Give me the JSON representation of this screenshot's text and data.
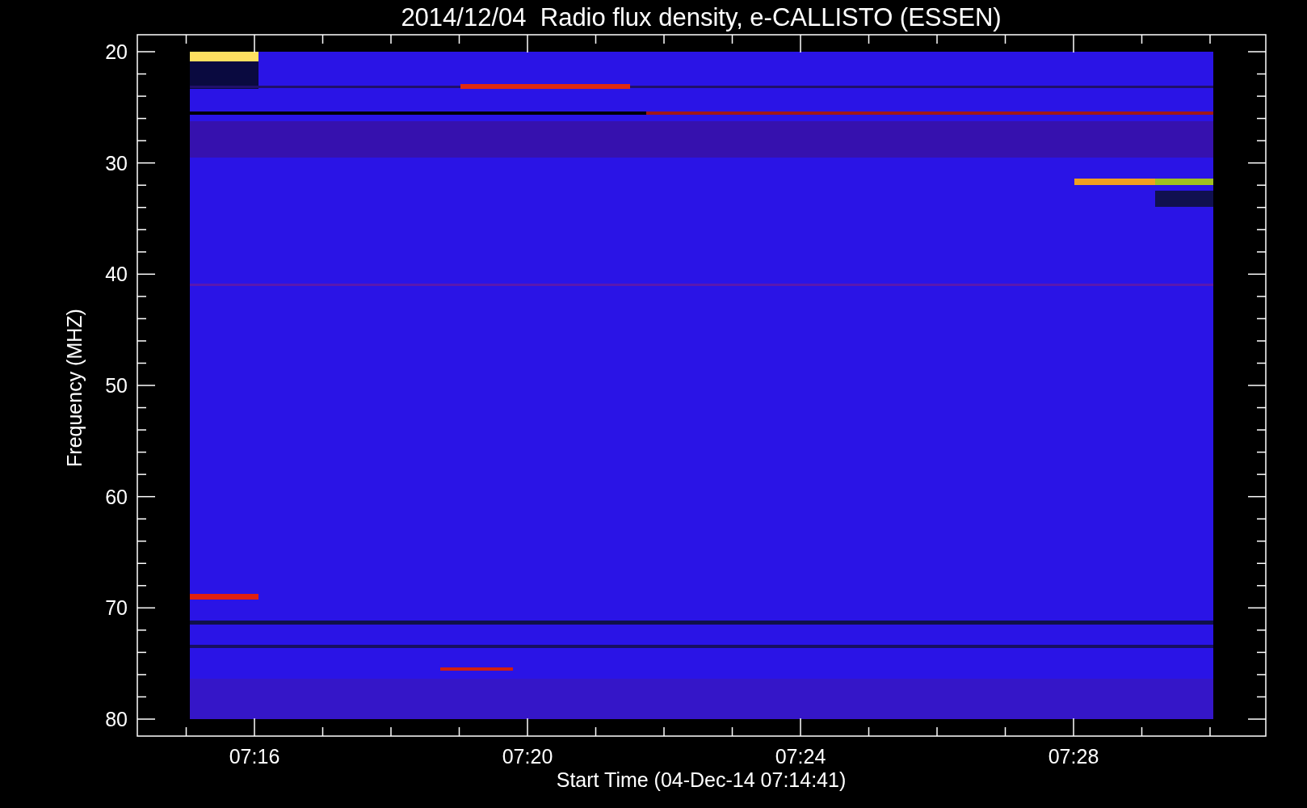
{
  "title": "2014/12/04  Radio flux density, e-CALLISTO (ESSEN)",
  "y_axis": {
    "label": "Frequency (MHZ)",
    "ticks": [
      "20",
      "30",
      "40",
      "50",
      "60",
      "70",
      "80"
    ]
  },
  "x_axis": {
    "label": "Start Time (04-Dec-14 07:14:41)",
    "ticks": [
      "07:16",
      "07:20",
      "07:24",
      "07:28"
    ]
  }
}
